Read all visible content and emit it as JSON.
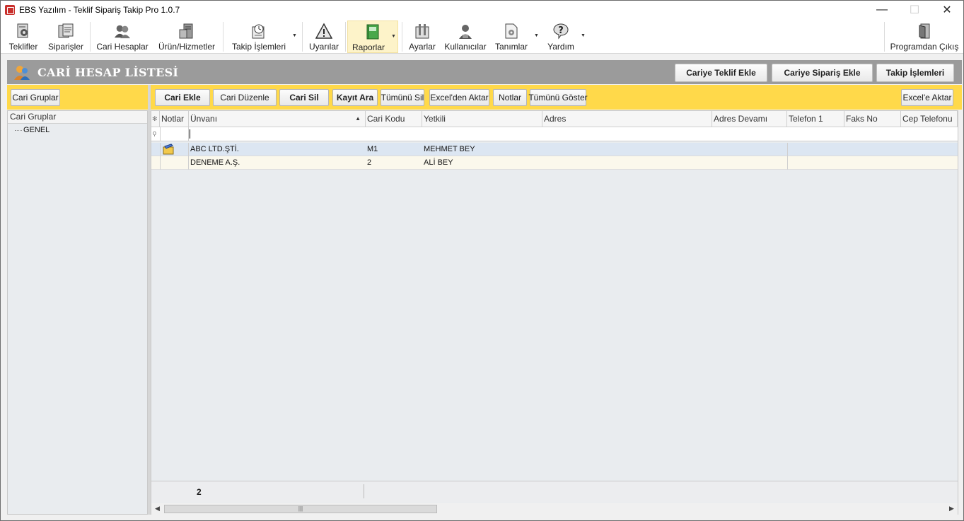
{
  "window": {
    "title": "EBS Yazılım - Teklif Sipariş Takip Pro 1.0.7",
    "minimize": "—",
    "maximize": "☐",
    "close": "✕"
  },
  "toolbar": {
    "teklifler": "Teklifler",
    "siparisler": "Siparişler",
    "cari_hesaplar": "Cari Hesaplar",
    "urun_hizmetler": "Ürün/Hizmetler",
    "takip_islemleri": "Takip İşlemleri",
    "uyarilar": "Uyarılar",
    "raporlar": "Raporlar",
    "ayarlar": "Ayarlar",
    "kullanicilar": "Kullanıcılar",
    "tanimlar": "Tanımlar",
    "yardim": "Yardım",
    "programdan_cikis": "Programdan Çıkış",
    "dropdown_arrow": "▼"
  },
  "page": {
    "title": "CARİ HESAP LİSTESİ",
    "header_buttons": {
      "cariye_teklif_ekle": "Cariye Teklif Ekle",
      "cariye_siparis_ekle": "Cariye Sipariş Ekle",
      "takip_islemleri": "Takip İşlemleri"
    }
  },
  "left_panel": {
    "button": "Cari Gruplar",
    "tree_header": "Cari Gruplar",
    "items": [
      "GENEL"
    ]
  },
  "actions": {
    "cari_ekle": "Cari Ekle",
    "cari_duzenle": "Cari Düzenle",
    "cari_sil": "Cari Sil",
    "kayit_ara": "Kayıt Ara",
    "tumunu_sil": "Tümünü Sil",
    "excelden_aktar": "Excel'den Aktar",
    "notlar": "Notlar",
    "tumunu_goster": "Tümünü Göster",
    "excele_aktar": "Excel'e Aktar"
  },
  "grid": {
    "columns": {
      "notlar": "Notlar",
      "unvani": "Ünvanı",
      "cari_kodu": "Cari Kodu",
      "yetkili": "Yetkili",
      "adres": "Adres",
      "adres_devami": "Adres Devamı",
      "telefon_1": "Telefon 1",
      "faks_no": "Faks No",
      "cep_telefonu": "Cep Telefonu"
    },
    "rows": [
      {
        "unvani": "ABC LTD.ŞTİ.",
        "cari_kodu": "M1",
        "yetkili": "MEHMET BEY"
      },
      {
        "unvani": "DENEME A.Ş.",
        "cari_kodu": "2",
        "yetkili": "ALİ BEY"
      }
    ],
    "record_count": "2",
    "sort_indicator": "▲",
    "newrow_glyph": "✻",
    "filter_glyph": "ϙ",
    "scroll_left": "◀",
    "scroll_right": "▶",
    "scroll_grip": "|||"
  },
  "colors": {
    "accent_yellow": "#ffd94a",
    "header_gray": "#9b9b9b",
    "selected_row": "#dce6f2"
  }
}
